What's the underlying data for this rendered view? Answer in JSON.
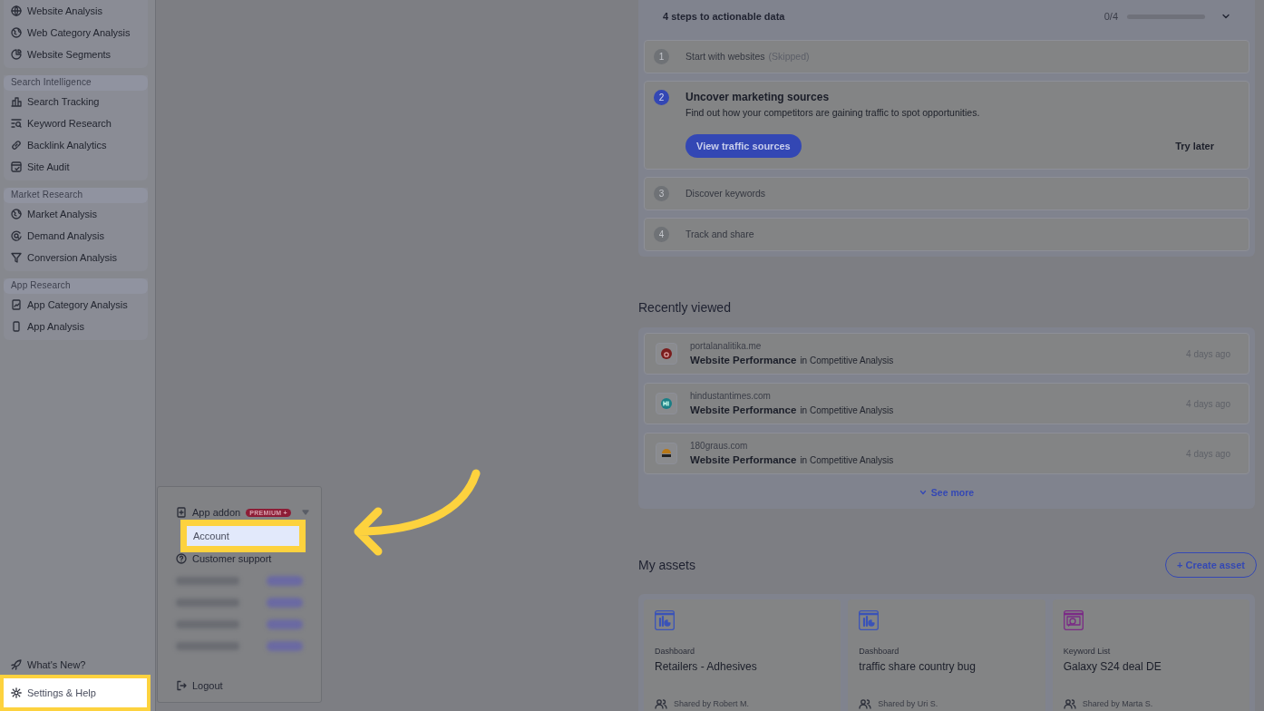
{
  "sidebar": {
    "sections": [
      {
        "items": [
          {
            "label": "Website Analysis"
          },
          {
            "label": "Web Category Analysis"
          },
          {
            "label": "Website Segments"
          }
        ]
      },
      {
        "header": "Search Intelligence",
        "items": [
          {
            "label": "Search Tracking"
          },
          {
            "label": "Keyword Research"
          },
          {
            "label": "Backlink Analytics"
          },
          {
            "label": "Site Audit"
          }
        ]
      },
      {
        "header": "Market Research",
        "items": [
          {
            "label": "Market Analysis"
          },
          {
            "label": "Demand Analysis"
          },
          {
            "label": "Conversion Analysis"
          }
        ]
      },
      {
        "header": "App Research",
        "items": [
          {
            "label": "App Category Analysis"
          },
          {
            "label": "App Analysis"
          }
        ]
      }
    ],
    "footer": [
      {
        "label": "What's New?",
        "highlighted": false
      },
      {
        "label": "Settings & Help",
        "highlighted": true
      }
    ]
  },
  "menu": {
    "items": [
      {
        "kind": "addon",
        "label": "App addon",
        "badge": "PREMIUM +"
      },
      {
        "kind": "account",
        "label": "Account",
        "highlighted": true
      },
      {
        "kind": "support",
        "label": "Customer support",
        "highlighted": false
      },
      {
        "kind": "redacted"
      },
      {
        "kind": "redacted"
      },
      {
        "kind": "redacted"
      },
      {
        "kind": "redacted"
      },
      {
        "kind": "logout",
        "label": "Logout",
        "highlighted": false
      }
    ]
  },
  "onboarding": {
    "title": "4 steps to actionable data",
    "progress_text": "0/4",
    "progress": {
      "level": 0
    },
    "steps": [
      {
        "number": "1",
        "title": "Start with websites",
        "note": "(Skipped)",
        "active": false
      },
      {
        "number": "2",
        "title": "Uncover marketing sources",
        "active": true,
        "description": "Find out how your competitors are gaining traffic to spot opportunities.",
        "action": "View traffic sources",
        "secondary": "Try later"
      },
      {
        "number": "3",
        "title": "Discover keywords",
        "active": false
      },
      {
        "number": "4",
        "title": "Track and share",
        "active": false
      }
    ]
  },
  "recently_viewed": {
    "title": "Recently viewed",
    "rows": [
      {
        "site": "portalanalitika.me",
        "report": "Website Performance",
        "context": "in Competitive Analysis",
        "time": "4 days ago"
      },
      {
        "site": "hindustantimes.com",
        "report": "Website Performance",
        "context": "in Competitive Analysis",
        "time": "4 days ago"
      },
      {
        "site": "180graus.com",
        "report": "Website Performance",
        "context": "in Competitive Analysis",
        "time": "4 days ago"
      }
    ],
    "see_more": "See more"
  },
  "assets": {
    "title": "My assets",
    "create": "+ Create asset",
    "cards": [
      {
        "kind": "dashboard",
        "type": "Dashboard",
        "name": "Retailers - Adhesives",
        "shared": "Shared by Robert M."
      },
      {
        "kind": "dashboard",
        "type": "Dashboard",
        "name": "traffic share country bug",
        "shared": "Shared by Uri S."
      },
      {
        "kind": "keywords",
        "type": "Keyword List",
        "name": "Galaxy S24 deal DE",
        "shared": "Shared by Marta S."
      }
    ]
  }
}
